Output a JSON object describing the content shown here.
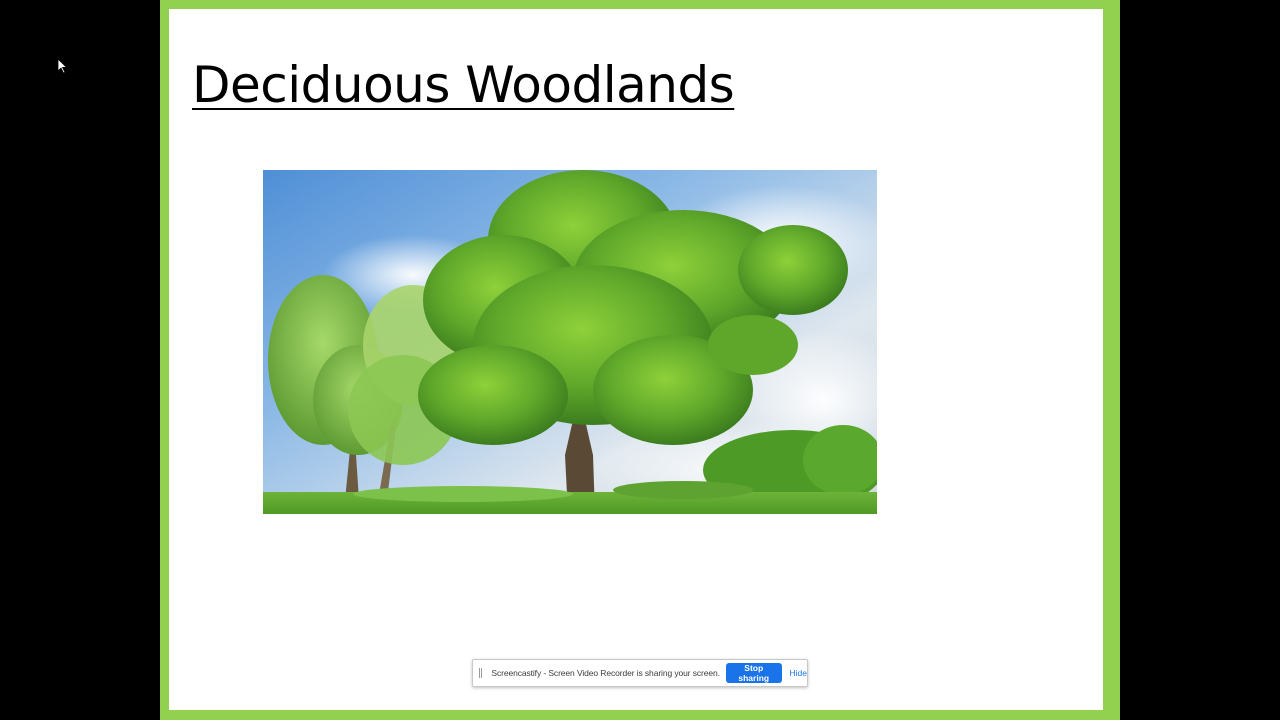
{
  "slide": {
    "title": "Deciduous Woodlands",
    "frame_color": "#92d050",
    "image_description_icon": "deciduous-tree-photo"
  },
  "share_bar": {
    "message": "Screencastify - Screen Video Recorder is sharing your screen.",
    "stop_label": "Stop sharing",
    "hide_label": "Hide",
    "accent_color": "#1a73e8"
  }
}
